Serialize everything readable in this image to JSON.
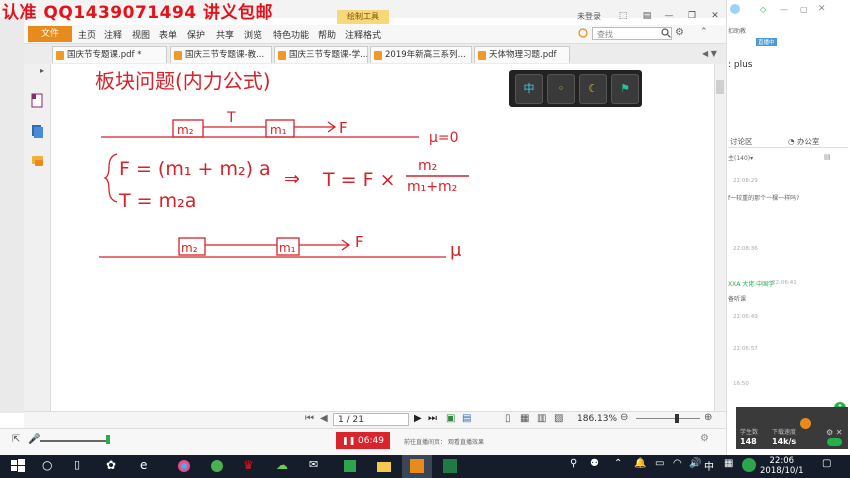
{
  "watermark": "认准 QQ1439071494 讲义包邮",
  "titlebar": {
    "context_tab": "绘制工具",
    "login": "未登录"
  },
  "ribbon": {
    "file": "文件",
    "items": [
      "主页",
      "注释",
      "视图",
      "表单",
      "保护",
      "共享",
      "浏览",
      "特色功能",
      "帮助",
      "注释格式"
    ],
    "search_placeholder": "查找"
  },
  "tabs": [
    {
      "label": "国庆节专题课.pdf *"
    },
    {
      "label": "国庆三节专题课-教..."
    },
    {
      "label": "国庆三节专题课-学..."
    },
    {
      "label": "2019年新高三系列..."
    },
    {
      "label": "天体物理习题.pdf"
    }
  ],
  "mini_toolbar": {
    "btn1": "中"
  },
  "board": {
    "title": "板块问题(内力公式)",
    "block_m2": "m₂",
    "block_m1": "m₁",
    "tension": "T",
    "force": "F",
    "mu_zero": "μ=0",
    "eq1": "F = (m₁ + m₂) a",
    "implies": "⇒",
    "eq_result_lhs": "T = F ×",
    "frac_num": "m₂",
    "frac_den": "m₁+m₂",
    "eq2": "T =  m₂a",
    "block2_m2": "m₂",
    "block2_m1": "m₁",
    "force2": "F",
    "mu": "μ"
  },
  "status": {
    "page": "1 / 21",
    "zoom": "186.13%"
  },
  "stream": {
    "timer": "06:49",
    "info1": "前往直播间页：",
    "info2": "观看直播效果"
  },
  "chat": {
    "title_frag": "扣助教",
    "badge": "直播中",
    "plus": ": plus",
    "tab_discuss": "讨论区",
    "tab_office": "办公室",
    "count": "(140)",
    "messages": [
      {
        "time": "22:08:29",
        "text": ""
      },
      {
        "time": "",
        "text": "f一较重的那个一棵一样吗?"
      },
      {
        "time": "22:08:36",
        "text": ""
      },
      {
        "time": "22:06:41",
        "text": "XXA 大佬 中国学"
      },
      {
        "time": "",
        "text": "备听课"
      },
      {
        "time": "22:06:49",
        "text": ""
      },
      {
        "time": "22:06:57",
        "text": ""
      },
      {
        "time": "16:50",
        "text": ""
      }
    ],
    "net_label": "学生数",
    "net_value": "148",
    "speed_label": "下载速度",
    "speed_value": "14k/s"
  },
  "clock": {
    "time": "22:06",
    "date": "2018/10/1"
  },
  "colors": {
    "accent": "#e98a1c",
    "ink": "#d6222a",
    "taskbar": "#151d2a"
  }
}
